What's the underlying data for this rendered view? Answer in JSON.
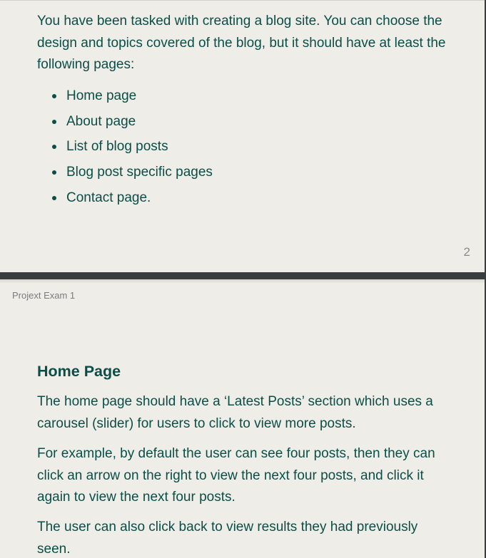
{
  "page_top": {
    "intro": "You have been tasked with creating a blog site. You can choose the design and topics covered of the blog, but it should have at least the following pages:",
    "required_pages": [
      "Home page",
      "About page",
      "List of blog posts",
      "Blog post specific pages",
      "Contact page."
    ],
    "page_number": "2"
  },
  "page_bottom": {
    "running_header": "Projext Exam 1",
    "heading": "Home Page",
    "paragraphs": [
      "The home page should have a ‘Latest Posts’ section which uses a carousel (slider) for users to click to view more posts.",
      "For example, by default the user can see four posts, then they can click an arrow on the right to view the next four posts, and click it again to view the next four posts.",
      "The user can also click back to view results they had previously seen."
    ]
  },
  "colors": {
    "page_background": "#efede8",
    "gap_background": "#3a3d3f",
    "text": "#0b4e48",
    "muted_text": "#7a7c7b"
  }
}
